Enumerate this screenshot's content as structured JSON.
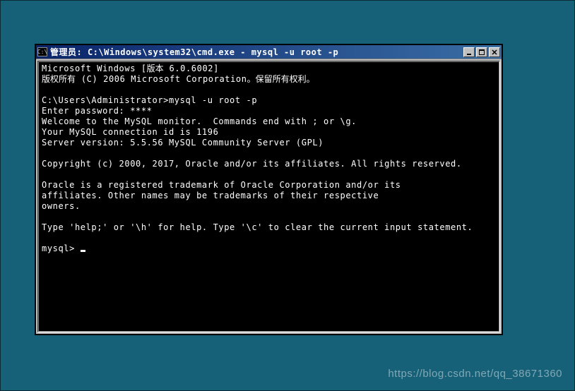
{
  "window": {
    "title": "管理员: C:\\Windows\\system32\\cmd.exe - mysql  -u root -p",
    "icon_label": "C:\\"
  },
  "terminal": {
    "l1a": "Microsoft Windows [",
    "l1b": "版本",
    "l1c": " 6.0.6002]",
    "l2a": "版权所有",
    "l2b": " (C) 2006 Microsoft Corporation",
    "l2c": "。保留所有权利。",
    "l3": "",
    "l4": "C:\\Users\\Administrator>mysql -u root -p",
    "l5": "Enter password: ****",
    "l6": "Welcome to the MySQL monitor.  Commands end with ; or \\g.",
    "l7": "Your MySQL connection id is 1196",
    "l8": "Server version: 5.5.56 MySQL Community Server (GPL)",
    "l9": "",
    "l10": "Copyright (c) 2000, 2017, Oracle and/or its affiliates. All rights reserved.",
    "l11": "",
    "l12": "Oracle is a registered trademark of Oracle Corporation and/or its",
    "l13": "affiliates. Other names may be trademarks of their respective",
    "l14": "owners.",
    "l15": "",
    "l16": "Type 'help;' or '\\h' for help. Type '\\c' to clear the current input statement.",
    "l17": "",
    "prompt": "mysql> "
  },
  "watermark": "https://blog.csdn.net/qq_38671360"
}
